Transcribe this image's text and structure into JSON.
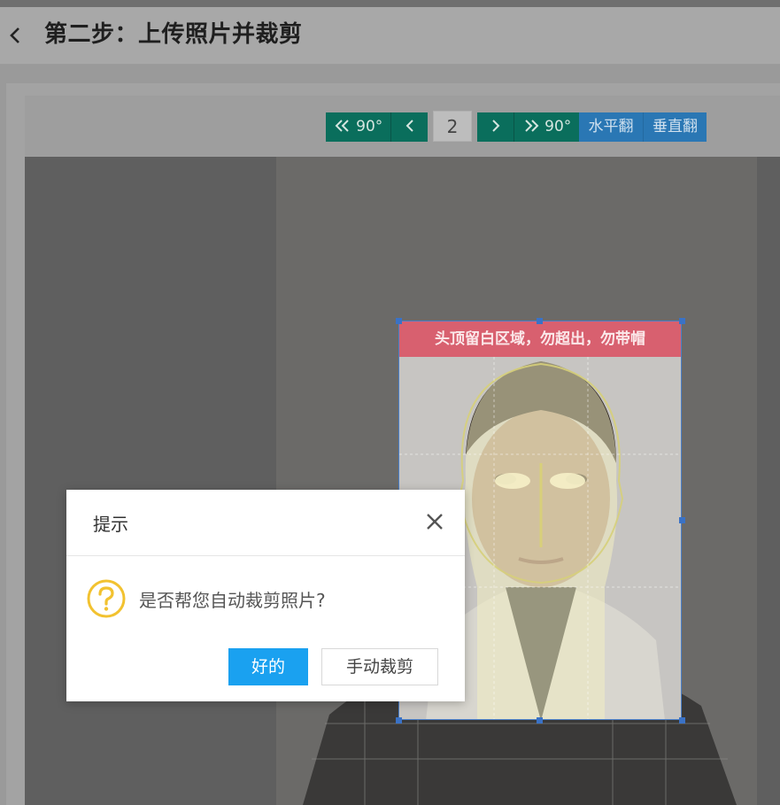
{
  "header": {
    "title": "第二步：上传照片并裁剪",
    "back_icon": "chevron-left-icon"
  },
  "toolbar": {
    "rotate_left_label": "90°",
    "prev_label": "",
    "page_number": "2",
    "next_label": "",
    "rotate_right_label": "90°",
    "flip_horizontal_label": "水平翻",
    "flip_vertical_label": "垂直翻",
    "colors": {
      "green": "#0a6e5c",
      "blue": "#2a77b4"
    }
  },
  "crop": {
    "banner_text": "头顶留白区域，勿超出，勿带帽"
  },
  "dialog": {
    "title": "提示",
    "message": "是否帮您自动裁剪照片?",
    "ok_label": "好的",
    "manual_label": "手动裁剪",
    "icon": "question-icon",
    "accent_color": "#1aa1f0"
  }
}
